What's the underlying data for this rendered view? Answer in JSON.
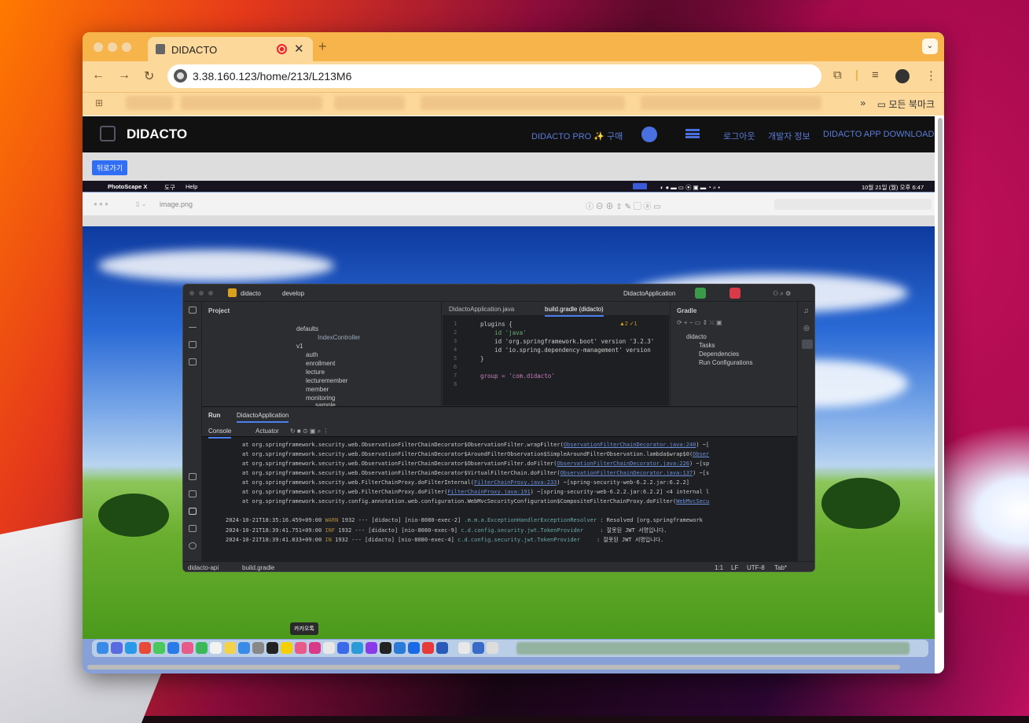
{
  "browser": {
    "tab_title": "DIDACTO",
    "tab_close": "✕",
    "new_tab": "+",
    "url": "3.38.160.123/home/213/L213M6",
    "bookmarks_more": "»",
    "bookmarks_all": "모든 북마크",
    "accent": "#f6b44a"
  },
  "site": {
    "brand": "DIDACTO",
    "nav": {
      "pro": "DIDACTO PRO ✨ 구매",
      "logout": "로그아웃",
      "dev_info": "개발자 정보",
      "download": "DIDACTO APP DOWNLOAD"
    },
    "back_button": "뒤로가기"
  },
  "mac": {
    "menubar": {
      "app": "PhotoScape X",
      "menu1": "도구",
      "menu2": "Help",
      "clock": "10월 21일 (월) 오후 6:47"
    },
    "preview_title": "image.png",
    "dock_tooltip": "카카오톡"
  },
  "ide": {
    "project": "didacto",
    "branch": "develop",
    "run_config": "DidactoApplication",
    "project_panel": "Project",
    "tree": [
      "defaults",
      "IndexController",
      "v1",
      "auth",
      "enrollment",
      "lecture",
      "lecturemember",
      "member",
      "monitoring",
      "sample"
    ],
    "editor_tabs": [
      "DidactoApplication.java",
      "build.gradle (didacto)"
    ],
    "code": [
      {
        "n": "1",
        "t": "plugins {"
      },
      {
        "n": "2",
        "t": "    id 'java'"
      },
      {
        "n": "3",
        "t": "    id 'org.springframework.boot' version '3.2.3'"
      },
      {
        "n": "4",
        "t": "    id 'io.spring.dependency-management' version"
      },
      {
        "n": "5",
        "t": "}"
      },
      {
        "n": "6",
        "t": ""
      },
      {
        "n": "7",
        "t": "group = 'com.didacto'"
      },
      {
        "n": "8",
        "t": ""
      }
    ],
    "inspection": "▲2 ✓1",
    "gradle": {
      "title": "Gradle",
      "root": "didacto",
      "items": [
        "Tasks",
        "Dependencies",
        "Run Configurations"
      ]
    },
    "run": {
      "tab": "Run",
      "config": "DidactoApplication",
      "console": "Console",
      "actuator": "Actuator"
    },
    "stack": [
      {
        "pre": "at org.springframework.security.web.ObservationFilterChainDecorator$ObservationFilter.wrapFilter(",
        "link": "ObservationFilterChainDecorator.java:240",
        "post": ") ~["
      },
      {
        "pre": "at org.springframework.security.web.ObservationFilterChainDecorator$AroundFilterObservation$SimpleAroundFilterObservation.lambda$wrap$0(",
        "link": "Obser",
        "post": ""
      },
      {
        "pre": "at org.springframework.security.web.ObservationFilterChainDecorator$ObservationFilter.doFilter(",
        "link": "ObservationFilterChainDecorator.java:226",
        "post": ") ~[sp"
      },
      {
        "pre": "at org.springframework.security.web.ObservationFilterChainDecorator$VirtualFilterChain.doFilter(",
        "link": "ObservationFilterChainDecorator.java:137",
        "post": ") ~[s"
      },
      {
        "pre": "at org.springframework.security.web.FilterChainProxy.doFilterInternal(",
        "link": "FilterChainProxy.java:233",
        "post": ") ~[spring-security-web-6.2.2.jar:6.2.2]"
      },
      {
        "pre": "at org.springframework.security.web.FilterChainProxy.doFilter(",
        "link": "FilterChainProxy.java:191",
        "post": ") ~[spring-security-web-6.2.2.jar:6.2.2] <4 internal l"
      },
      {
        "pre": "at org.springframework.security.config.annotation.web.configuration.WebMvcSecurityConfiguration$CompositeFilterChainProxy.doFilter(",
        "link": "WebMvcSecu",
        "post": ""
      }
    ],
    "logs": [
      {
        "ts": "2024-10-21T18:35:16.459+09:00",
        "lvl": "WARN",
        "mid": " 1932 --- [didacto] [nio-8080-exec-2] ",
        "src": ".m.m.a.ExceptionHandlerExceptionResolver",
        "msg": " : Resolved [org.springframework"
      },
      {
        "ts": "2024-10-21T18:39:41.751+09:00",
        "lvl": "INF",
        "mid": " 1932 --- [didacto] [nio-8080-exec-9] ",
        "src": "c.d.config.security.jwt.TokenProvider",
        "msg": "     : 잘못된 JWT 서명입니다."
      },
      {
        "ts": "2024-10-21T18:39:41.833+09:00",
        "lvl": "IN",
        "mid": " 1932 --- [didacto] [nio-8080-exec-4] ",
        "src": "c.d.config.security.jwt.TokenProvider",
        "msg": "     : 잘못된 JWT 서명입니다."
      }
    ],
    "status": {
      "crumb1": "didacto-api",
      "crumb2": "build.gradle",
      "pos": "1:1",
      "lf": "LF",
      "enc": "UTF-8",
      "indent": "Tab*"
    }
  }
}
